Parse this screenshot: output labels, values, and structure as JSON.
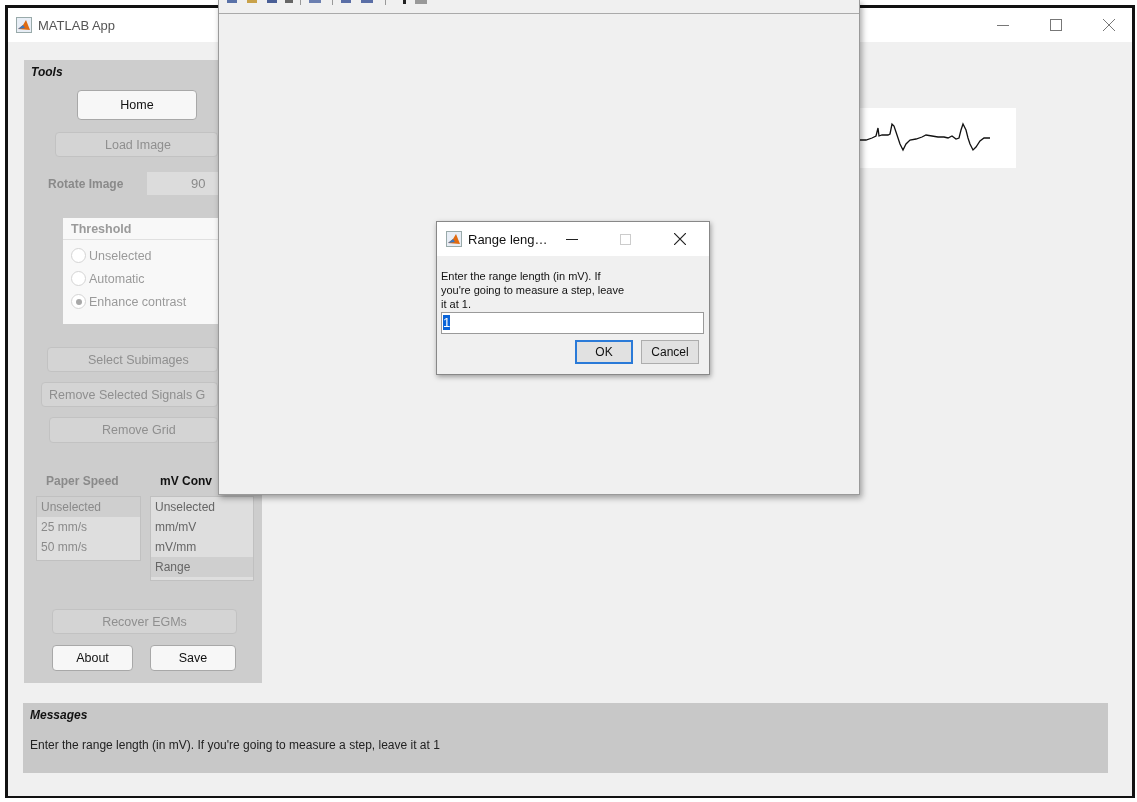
{
  "main_window": {
    "title": "MATLAB App",
    "tools": {
      "title": "Tools",
      "buttons_top": [
        {
          "label": "Home",
          "disabled": false
        },
        {
          "label": "Load Image",
          "disabled": true
        }
      ],
      "rotate": {
        "label": "Rotate Image",
        "value": "90",
        "disabled": true
      },
      "threshold": {
        "title": "Threshold",
        "disabled": true,
        "options": [
          {
            "label": "Unselected",
            "selected": false
          },
          {
            "label": "Automatic",
            "selected": false
          },
          {
            "label": "Enhance contrast",
            "selected": true
          }
        ]
      },
      "buttons_mid": [
        {
          "label": "Select Subimages",
          "disabled": true
        },
        {
          "label": "Remove Selected Signals G",
          "disabled": true
        },
        {
          "label": "Remove Grid",
          "disabled": true
        }
      ],
      "lists": [
        {
          "title": "Paper Speed",
          "disabled": true,
          "items": [
            {
              "label": "Unselected",
              "selected": true
            },
            {
              "label": "25 mm/s",
              "selected": false
            },
            {
              "label": "50 mm/s",
              "selected": false
            }
          ]
        },
        {
          "title": "mV Conv",
          "disabled": false,
          "items": [
            {
              "label": "Unselected",
              "selected": false
            },
            {
              "label": "mm/mV",
              "selected": false
            },
            {
              "label": "mV/mm",
              "selected": false
            },
            {
              "label": "Range",
              "selected": true
            }
          ]
        }
      ],
      "buttons_bottom": [
        {
          "label": "Recover EGMs",
          "disabled": true
        },
        {
          "label": "About",
          "disabled": false
        },
        {
          "label": "Save",
          "disabled": false
        }
      ]
    },
    "messages": {
      "title": "Messages",
      "text": "Enter the range length (in mV). If you're going to measure a step, leave it at 1"
    }
  },
  "dialog": {
    "title": "Range leng…",
    "prompt": "Enter the range length (in mV). If you're going to measure a step, leave it at 1.",
    "value": "1",
    "text_selected": true,
    "buttons": [
      {
        "label": "OK",
        "focused": true
      },
      {
        "label": "Cancel",
        "focused": false
      }
    ]
  }
}
